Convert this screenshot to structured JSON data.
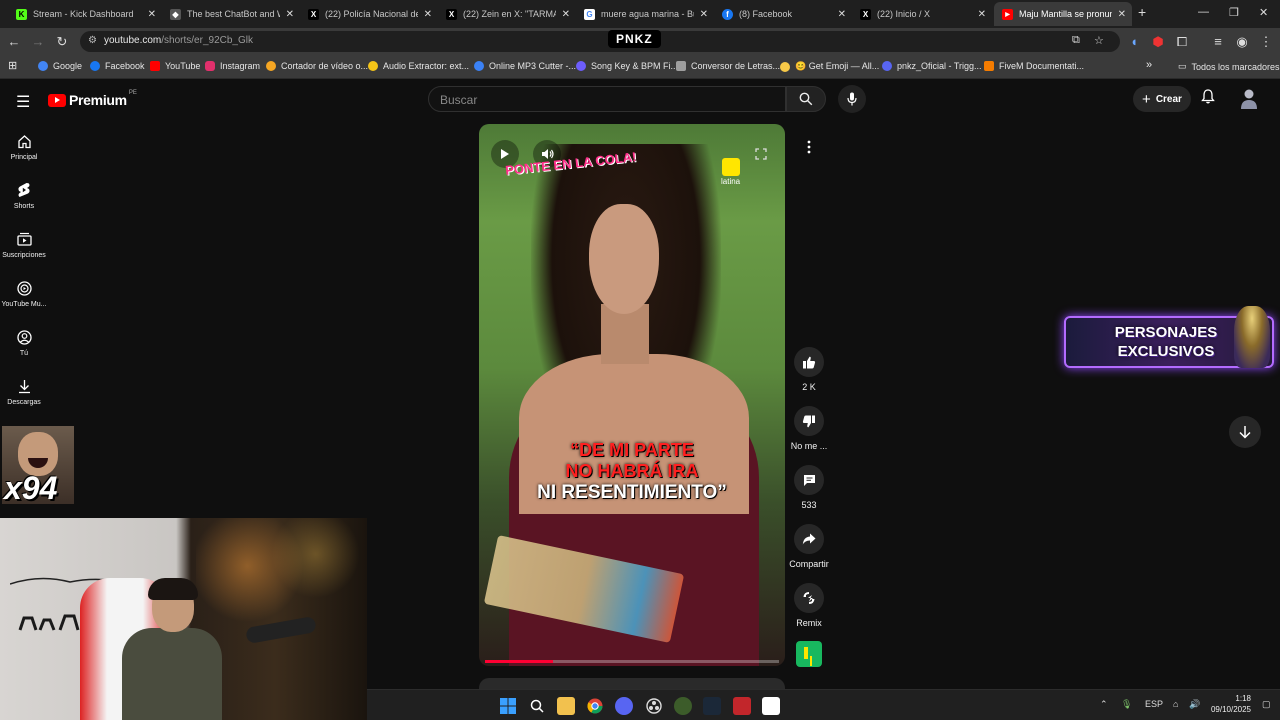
{
  "browser": {
    "tabs": [
      {
        "title": "Stream - Kick Dashboard",
        "favicon": "kick-icon",
        "color": "#53fc18",
        "glyph": "K"
      },
      {
        "title": "The best ChatBot and Wi...",
        "favicon": "chatbot-icon",
        "color": "#888888",
        "glyph": "◆"
      },
      {
        "title": "(22) Policía Nacional del P...",
        "favicon": "x-icon",
        "color": "#000000",
        "glyph": "X"
      },
      {
        "title": "(22) Zein en X: \"TARMALA...",
        "favicon": "x-icon",
        "color": "#000000",
        "glyph": "X"
      },
      {
        "title": "muere agua marina - Busc...",
        "favicon": "google-icon",
        "color": "#ffffff",
        "glyph": "G"
      },
      {
        "title": "(8) Facebook",
        "favicon": "facebook-icon",
        "color": "#1877f2",
        "glyph": "f"
      },
      {
        "title": "(22) Inicio / X",
        "favicon": "x-icon",
        "color": "#000000",
        "glyph": "X"
      },
      {
        "title": "Maju Mantilla se pronunc...",
        "favicon": "youtube-icon",
        "color": "#ff0000",
        "glyph": "▶",
        "active": true
      }
    ],
    "new_tab": "+",
    "url_host": "youtube.com",
    "url_path": "/shorts/er_92Cb_Glk",
    "extension_badge": "PNKZ",
    "bookmarks": [
      {
        "label": "Google",
        "color": "#4285f4"
      },
      {
        "label": "Facebook",
        "color": "#1877f2"
      },
      {
        "label": "YouTube",
        "color": "#ff0000"
      },
      {
        "label": "Instagram",
        "color": "#e1306c"
      },
      {
        "label": "Cortador de vídeo o...",
        "color": "#f5a623"
      },
      {
        "label": "Audio Extractor: ext...",
        "color": "#f5c518"
      },
      {
        "label": "Online MP3 Cutter -...",
        "color": "#3b82f6"
      },
      {
        "label": "Song Key & BPM Fi...",
        "color": "#6d5dfc"
      },
      {
        "label": "Conversor de Letras...",
        "color": "#9e9e9e"
      },
      {
        "label": "😊 Get Emoji — All...",
        "color": "#f7c948"
      },
      {
        "label": "pnkz_Oficial - Trigg...",
        "color": "#5865f2"
      },
      {
        "label": "FiveM Documentati...",
        "color": "#f57c00"
      }
    ],
    "all_bookmarks": "Todos los marcadores"
  },
  "youtube": {
    "logo_text": "Premium",
    "logo_country": "PE",
    "search_placeholder": "Buscar",
    "create_label": "Crear",
    "sidebar": [
      {
        "label": "Principal",
        "icon": "home-icon"
      },
      {
        "label": "Shorts",
        "icon": "shorts-icon"
      },
      {
        "label": "Suscripciones",
        "icon": "subscriptions-icon"
      },
      {
        "label": "YouTube Mu...",
        "icon": "youtube-music-icon"
      },
      {
        "label": "Tú",
        "icon": "you-icon"
      },
      {
        "label": "Descargas",
        "icon": "downloads-icon"
      }
    ],
    "short": {
      "overlay_logo": "PONTE EN LA COLA!",
      "channel_logo_text": "latina",
      "caption_lines": [
        "“DE MI PARTE",
        "NO HABRÁ IRA",
        "NI RESENTIMIENTO”"
      ],
      "progress": 0.23
    },
    "actions": {
      "like_count": "2 K",
      "dislike_label": "No me ...",
      "comment_count": "533",
      "share_label": "Compartir",
      "remix_label": "Remix"
    }
  },
  "overlays": {
    "promo_line1": "PERSONAJES",
    "promo_line2": "EXCLUSIVOS",
    "emote_count": "x94"
  },
  "taskbar": {
    "language": "ESP",
    "time": "1:18",
    "date": "09/10/2025"
  }
}
